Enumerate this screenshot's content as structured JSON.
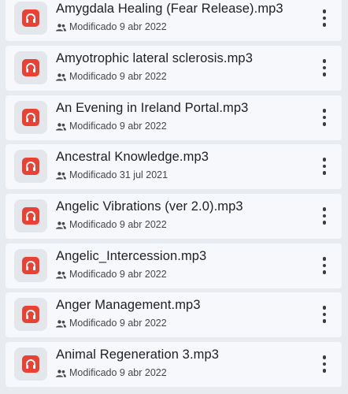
{
  "file_list": {
    "items": [
      {
        "name": "Amygdala Healing (Fear Release).mp3",
        "modified": "Modificado 9 abr 2022",
        "icon": "audio-file-icon"
      },
      {
        "name": "Amyotrophic lateral sclerosis.mp3",
        "modified": "Modificado 9 abr 2022",
        "icon": "audio-file-icon"
      },
      {
        "name": "An Evening in Ireland Portal.mp3",
        "modified": "Modificado 9 abr 2022",
        "icon": "audio-file-icon"
      },
      {
        "name": "Ancestral Knowledge.mp3",
        "modified": "Modificado 31 jul 2021",
        "icon": "audio-file-icon"
      },
      {
        "name": "Angelic Vibrations (ver 2.0).mp3",
        "modified": "Modificado 9 abr 2022",
        "icon": "audio-file-icon"
      },
      {
        "name": "Angelic_Intercession.mp3",
        "modified": "Modificado 9 abr 2022",
        "icon": "audio-file-icon"
      },
      {
        "name": "Anger Management.mp3",
        "modified": "Modificado 9 abr 2022",
        "icon": "audio-file-icon"
      },
      {
        "name": "Animal Regeneration 3.mp3",
        "modified": "Modificado 9 abr 2022",
        "icon": "audio-file-icon"
      }
    ]
  },
  "colors": {
    "file_icon_red": "#e94235",
    "row_background": "#f6f8fc",
    "page_background": "#e8ecf1"
  }
}
